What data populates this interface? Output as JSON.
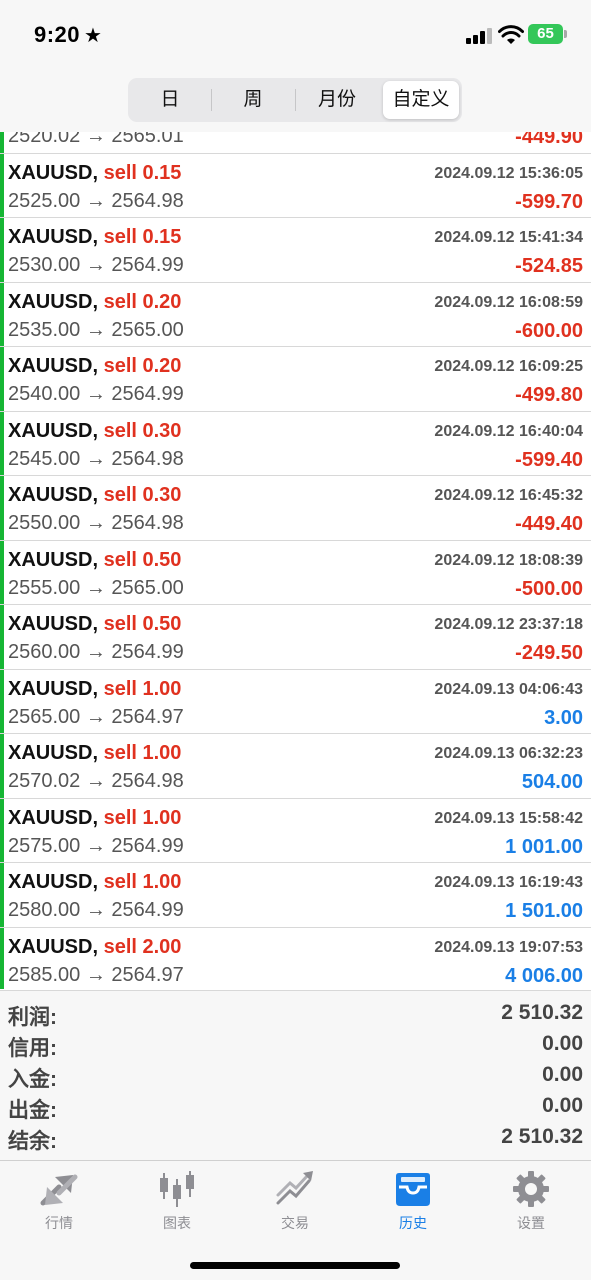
{
  "status_bar": {
    "time": "9:20",
    "battery": "65"
  },
  "segments": [
    {
      "label": "日"
    },
    {
      "label": "周"
    },
    {
      "label": "月份"
    },
    {
      "label": "自定义"
    }
  ],
  "partial_row": {
    "prices": "2520.02 → 2565.01",
    "profit": "-449.90"
  },
  "orders": [
    {
      "symbol": "XAUUSD,",
      "side": "sell 0.15",
      "datetime": "2024.09.12 15:36:05",
      "prices": "2525.00 → 2564.98",
      "profit": "-599.70",
      "profit_sign": "neg"
    },
    {
      "symbol": "XAUUSD,",
      "side": "sell 0.15",
      "datetime": "2024.09.12 15:41:34",
      "prices": "2530.00 → 2564.99",
      "profit": "-524.85",
      "profit_sign": "neg"
    },
    {
      "symbol": "XAUUSD,",
      "side": "sell 0.20",
      "datetime": "2024.09.12 16:08:59",
      "prices": "2535.00 → 2565.00",
      "profit": "-600.00",
      "profit_sign": "neg"
    },
    {
      "symbol": "XAUUSD,",
      "side": "sell 0.20",
      "datetime": "2024.09.12 16:09:25",
      "prices": "2540.00 → 2564.99",
      "profit": "-499.80",
      "profit_sign": "neg"
    },
    {
      "symbol": "XAUUSD,",
      "side": "sell 0.30",
      "datetime": "2024.09.12 16:40:04",
      "prices": "2545.00 → 2564.98",
      "profit": "-599.40",
      "profit_sign": "neg"
    },
    {
      "symbol": "XAUUSD,",
      "side": "sell 0.30",
      "datetime": "2024.09.12 16:45:32",
      "prices": "2550.00 → 2564.98",
      "profit": "-449.40",
      "profit_sign": "neg"
    },
    {
      "symbol": "XAUUSD,",
      "side": "sell 0.50",
      "datetime": "2024.09.12 18:08:39",
      "prices": "2555.00 → 2565.00",
      "profit": "-500.00",
      "profit_sign": "neg"
    },
    {
      "symbol": "XAUUSD,",
      "side": "sell 0.50",
      "datetime": "2024.09.12 23:37:18",
      "prices": "2560.00 → 2564.99",
      "profit": "-249.50",
      "profit_sign": "neg"
    },
    {
      "symbol": "XAUUSD,",
      "side": "sell 1.00",
      "datetime": "2024.09.13 04:06:43",
      "prices": "2565.00 → 2564.97",
      "profit": "3.00",
      "profit_sign": "pos"
    },
    {
      "symbol": "XAUUSD,",
      "side": "sell 1.00",
      "datetime": "2024.09.13 06:32:23",
      "prices": "2570.02 → 2564.98",
      "profit": "504.00",
      "profit_sign": "pos"
    },
    {
      "symbol": "XAUUSD,",
      "side": "sell 1.00",
      "datetime": "2024.09.13 15:58:42",
      "prices": "2575.00 → 2564.99",
      "profit": "1 001.00",
      "profit_sign": "pos"
    },
    {
      "symbol": "XAUUSD,",
      "side": "sell 1.00",
      "datetime": "2024.09.13 16:19:43",
      "prices": "2580.00 → 2564.99",
      "profit": "1 501.00",
      "profit_sign": "pos"
    },
    {
      "symbol": "XAUUSD,",
      "side": "sell 2.00",
      "datetime": "2024.09.13 19:07:53",
      "prices": "2585.00 → 2564.97",
      "profit": "4 006.00",
      "profit_sign": "pos"
    }
  ],
  "summary": [
    {
      "label": "利润:",
      "value": "2 510.32"
    },
    {
      "label": "信用:",
      "value": "0.00"
    },
    {
      "label": "入金:",
      "value": "0.00"
    },
    {
      "label": "出金:",
      "value": "0.00"
    },
    {
      "label": "结余:",
      "value": "2 510.32"
    }
  ],
  "tabs": [
    {
      "label": "行情",
      "icon": "quotes-icon"
    },
    {
      "label": "图表",
      "icon": "chart-icon"
    },
    {
      "label": "交易",
      "icon": "trade-icon"
    },
    {
      "label": "历史",
      "icon": "history-icon",
      "active": true
    },
    {
      "label": "设置",
      "icon": "settings-icon"
    }
  ],
  "colors": {
    "positive": "#1a7fe6",
    "negative": "#e0311f",
    "buy_bar": "#16b634",
    "active_tab": "#1a7fe6"
  }
}
